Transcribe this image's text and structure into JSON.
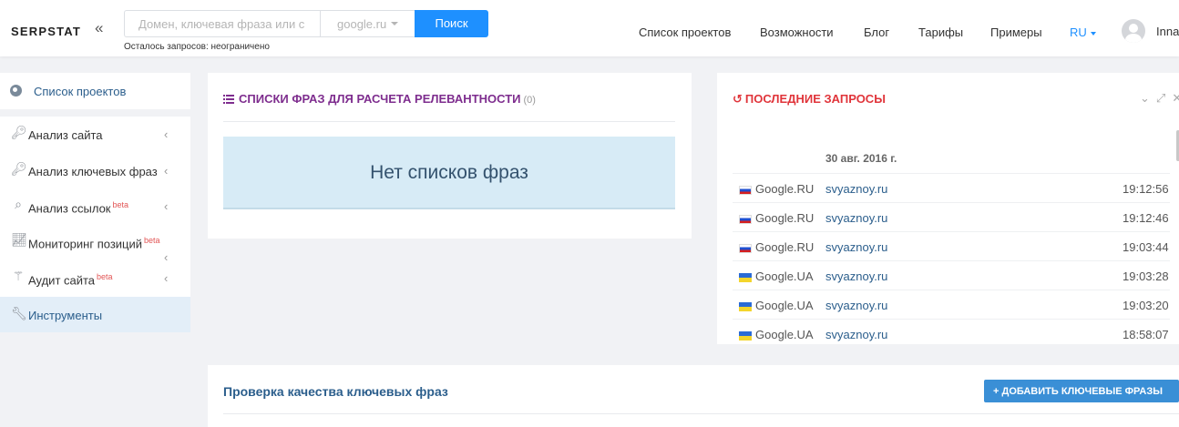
{
  "header": {
    "logo": "SERPSTAT",
    "collapse_icon": "«",
    "search_placeholder": "Домен, ключевая фраза или с",
    "engine_selected": "google.ru",
    "search_button": "Поиск",
    "quota_text": "Осталось запросов: неограничено",
    "nav": [
      "Список проектов",
      "Возможности",
      "Блог",
      "Тарифы",
      "Примеры"
    ],
    "lang": "RU",
    "user_name": "Inna"
  },
  "sidebar": {
    "projects": {
      "label": "Список проектов",
      "icon": "globe-icon"
    },
    "items": [
      {
        "label": "Анализ сайта",
        "icon": "key-icon",
        "beta": ""
      },
      {
        "label": "Анализ ключевых фраз",
        "icon": "keys-icon",
        "beta": ""
      },
      {
        "label": "Анализ ссылок",
        "icon": "search-icon",
        "beta": "beta"
      },
      {
        "label": "Мониторинг позиций",
        "icon": "chart-line-icon",
        "beta": "beta"
      },
      {
        "label": "Аудит сайта",
        "icon": "magic-wand-icon",
        "beta": "beta"
      },
      {
        "label": "Инструменты",
        "icon": "wrench-icon",
        "beta": ""
      }
    ]
  },
  "phrase_lists": {
    "title": "СПИСКИ ФРАЗ ДЛЯ РАСЧЕТА РЕЛЕВАНТНОСТИ",
    "count": "(0)",
    "empty_text": "Нет списков фраз"
  },
  "recent_requests": {
    "title": "ПОСЛЕДНИЕ ЗАПРОСЫ",
    "date": "30 авг. 2016 г.",
    "rows": [
      {
        "flag": "ru",
        "engine": "Google.RU",
        "domain": "svyaznoy.ru",
        "time": "19:12:56"
      },
      {
        "flag": "ru",
        "engine": "Google.RU",
        "domain": "svyaznoy.ru",
        "time": "19:12:46"
      },
      {
        "flag": "ru",
        "engine": "Google.RU",
        "domain": "svyaznoy.ru",
        "time": "19:03:44"
      },
      {
        "flag": "ua",
        "engine": "Google.UA",
        "domain": "svyaznoy.ru",
        "time": "19:03:28"
      },
      {
        "flag": "ua",
        "engine": "Google.UA",
        "domain": "svyaznoy.ru",
        "time": "19:03:20"
      },
      {
        "flag": "ua",
        "engine": "Google.UA",
        "domain": "svyaznoy.ru",
        "time": "18:58:07"
      }
    ]
  },
  "quality_check": {
    "title": "Проверка качества ключевых фраз",
    "add_button": "ДОБАВИТЬ КЛЮЧЕВЫЕ ФРАЗЫ"
  },
  "colors": {
    "accent": "#1e90ff",
    "phrase_title": "#7e2d8e",
    "recent_title": "#e0343a",
    "link": "#2b5e8c"
  }
}
